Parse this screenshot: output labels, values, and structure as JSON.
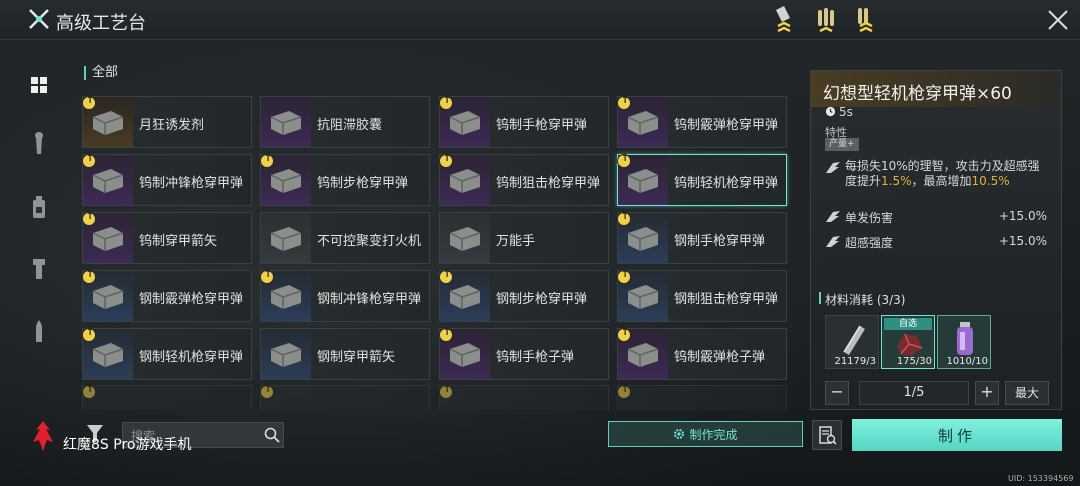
{
  "header": {
    "title": "高级工艺台"
  },
  "list": {
    "section_title": "全部",
    "items": [
      {
        "name": "月狂诱发剂",
        "rarity": "orange",
        "upgrade": true
      },
      {
        "name": "抗阻滞胶囊",
        "rarity": "purple",
        "upgrade": false
      },
      {
        "name": "钨制手枪穿甲弹",
        "rarity": "purple",
        "upgrade": true
      },
      {
        "name": "钨制霰弹枪穿甲弹",
        "rarity": "purple",
        "upgrade": true
      },
      {
        "name": "钨制冲锋枪穿甲弹",
        "rarity": "purple",
        "upgrade": true
      },
      {
        "name": "钨制步枪穿甲弹",
        "rarity": "purple",
        "upgrade": true
      },
      {
        "name": "钨制狙击枪穿甲弹",
        "rarity": "purple",
        "upgrade": true
      },
      {
        "name": "钨制轻机枪穿甲弹",
        "rarity": "purple",
        "upgrade": true,
        "selected": true
      },
      {
        "name": "钨制穿甲箭矢",
        "rarity": "purple",
        "upgrade": true
      },
      {
        "name": "不可控聚变打火机",
        "rarity": "gray",
        "upgrade": false
      },
      {
        "name": "万能手",
        "rarity": "gray",
        "upgrade": false
      },
      {
        "name": "钢制手枪穿甲弹",
        "rarity": "blue",
        "upgrade": true
      },
      {
        "name": "钢制霰弹枪穿甲弹",
        "rarity": "blue",
        "upgrade": true
      },
      {
        "name": "钢制冲锋枪穿甲弹",
        "rarity": "blue",
        "upgrade": true
      },
      {
        "name": "钢制步枪穿甲弹",
        "rarity": "blue",
        "upgrade": true
      },
      {
        "name": "钢制狙击枪穿甲弹",
        "rarity": "blue",
        "upgrade": true
      },
      {
        "name": "钢制轻机枪穿甲弹",
        "rarity": "blue",
        "upgrade": true
      },
      {
        "name": "钢制穿甲箭矢",
        "rarity": "blue",
        "upgrade": false
      },
      {
        "name": "钨制手枪子弹",
        "rarity": "purple",
        "upgrade": true
      },
      {
        "name": "钨制霰弹枪子弹",
        "rarity": "purple",
        "upgrade": true
      }
    ]
  },
  "search": {
    "placeholder": "搜索"
  },
  "brand": {
    "text": "红魔8S Pro游戏手机"
  },
  "craft_done_label": "制作完成",
  "detail": {
    "title": "幻想型轻机枪穿甲弹×60",
    "time": "5s",
    "traits_label": "特性",
    "tag": "产量+",
    "trait_desc_1": "每损失10%的理智，攻击力及超感强度提升",
    "trait_hl_1": "1.5%",
    "trait_desc_2": "，最高增加",
    "trait_hl_2": "10.5%",
    "stats": [
      {
        "label": "单发伤害",
        "value": "+15.0%"
      },
      {
        "label": "超感强度",
        "value": "+15.0%"
      }
    ],
    "materials_label": "材料消耗 (3/3)",
    "materials": [
      {
        "qty": "21179/3",
        "auto": false
      },
      {
        "qty": "175/30",
        "auto": true,
        "auto_label": "自选"
      },
      {
        "qty": "1010/10",
        "auto": false
      }
    ],
    "quantity": "1/5",
    "max_label": "最大",
    "craft_label": "制作"
  },
  "uid": "UID: 153394569",
  "colors": {
    "accent": "#6fe6d6",
    "highlight": "#e0b23c",
    "title_bar": "#4a3d22"
  }
}
